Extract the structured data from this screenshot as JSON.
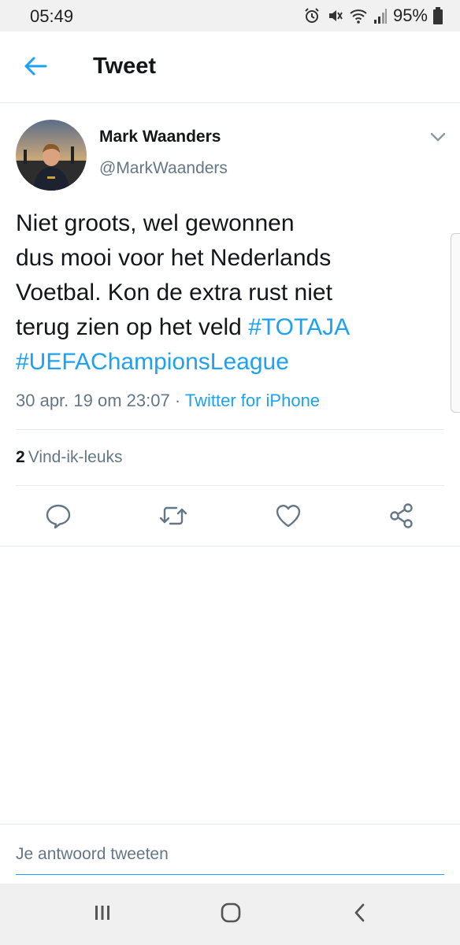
{
  "status_bar": {
    "time": "05:49",
    "battery": "95%",
    "icons": [
      "alarm-icon",
      "mute-icon",
      "wifi-icon",
      "signal-icon",
      "battery-icon"
    ]
  },
  "header": {
    "back_icon": "arrow-left-icon",
    "title": "Tweet"
  },
  "tweet": {
    "author_name": "Mark Waanders",
    "author_handle": "@MarkWaanders",
    "text_lines": [
      "Niet groots, wel gewonnen",
      "dus mooi voor het Nederlands",
      "Voetbal. Kon de extra rust niet",
      "terug zien op het veld "
    ],
    "hashtags": [
      "#TOTAJA",
      "#UEFAChampionsLeague"
    ],
    "timestamp": "30 apr. 19 om 23:07",
    "separator": " · ",
    "source": "Twitter for iPhone",
    "likes_count": "2",
    "likes_label": "Vind-ik-leuks"
  },
  "actions": [
    "reply-icon",
    "retweet-icon",
    "like-icon",
    "share-icon"
  ],
  "reply": {
    "placeholder": "Je antwoord tweeten"
  },
  "nav_bar": [
    "recents-icon",
    "home-icon",
    "back-icon"
  ],
  "colors": {
    "accent": "#1da1f2",
    "text": "#14171a",
    "secondary": "#657786",
    "border": "#e6ecf0"
  }
}
